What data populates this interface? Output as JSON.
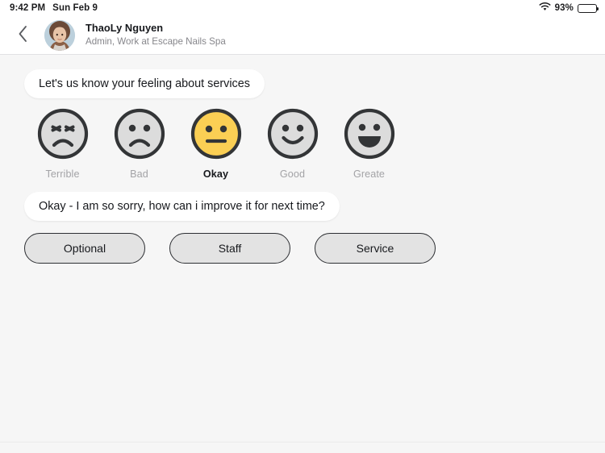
{
  "status_bar": {
    "time": "9:42 PM",
    "date": "Sun Feb 9",
    "battery_percent": "93%",
    "wifi_icon": "wifi-icon",
    "battery_icon": "battery-icon"
  },
  "header": {
    "back_icon": "chevron-left-icon",
    "avatar_icon": "user-avatar",
    "name": "ThaoLy Nguyen",
    "subtitle": "Admin, Work at Escape Nails Spa"
  },
  "conversation": {
    "question": "Let's us know your feeling about services",
    "answer": "Okay - I am so sorry, how can i improve it for next time?"
  },
  "ratings": {
    "selected_index": 2,
    "selected_color": "#FBCF54",
    "unselected_color": "#DCDCDC",
    "stroke_color": "#333537",
    "items": [
      {
        "label": "Terrible",
        "face": "face-terrible-icon",
        "selected": false
      },
      {
        "label": "Bad",
        "face": "face-bad-icon",
        "selected": false
      },
      {
        "label": "Okay",
        "face": "face-okay-icon",
        "selected": true
      },
      {
        "label": "Good",
        "face": "face-good-icon",
        "selected": false
      },
      {
        "label": "Greate",
        "face": "face-great-icon",
        "selected": false
      }
    ]
  },
  "actions": {
    "buttons": [
      {
        "label": "Optional"
      },
      {
        "label": "Staff"
      },
      {
        "label": "Service"
      }
    ]
  }
}
